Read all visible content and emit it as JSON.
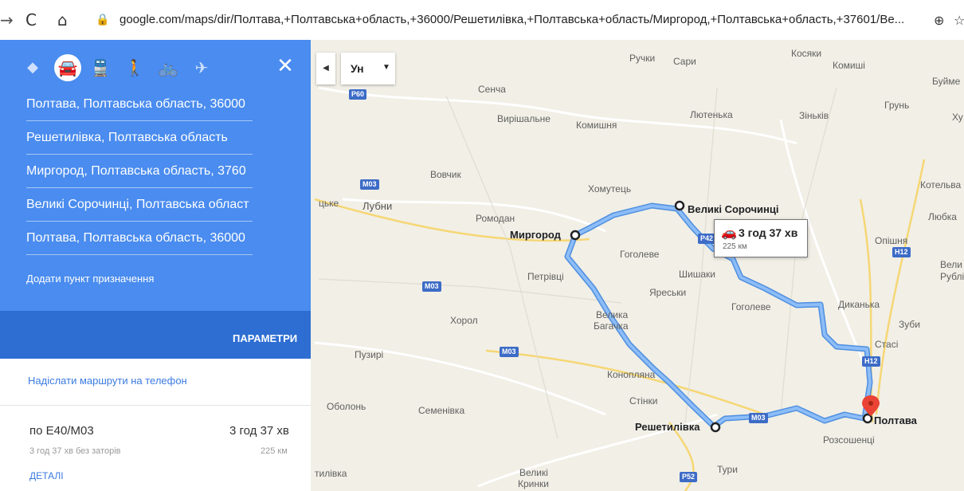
{
  "browser": {
    "url": "google.com/maps/dir/Полтава,+Полтавська+область,+36000/Решетилівка,+Полтавська+область/Миргород,+Полтавська+область,+37601/Ве..."
  },
  "panel": {
    "modes": [
      "directions-icon",
      "car-icon",
      "transit-icon",
      "walk-icon",
      "bike-icon",
      "flight-icon"
    ],
    "stops": [
      "Полтава, Полтавська область, 36000",
      "Решетилівка, Полтавська область",
      "Миргород, Полтавська область, 3760",
      "Великі Сорочинці, Полтавська област",
      "Полтава, Полтавська область, 36000"
    ],
    "add_destination": "Додати пункт призначення",
    "params_label": "ПАРАМЕТРИ",
    "send_to_phone": "Надіслати маршрути на телефон",
    "route": {
      "name": "по E40/M03",
      "time": "3 год 37 хв",
      "traffic": "3 год 37 хв без заторів",
      "distance": "225 км",
      "details": "ДЕТАЛІ"
    }
  },
  "map": {
    "layer_label": "Ун",
    "info": {
      "time": "3 год 37 хв",
      "distance": "225 км"
    },
    "stops": [
      {
        "name": "Миргород"
      },
      {
        "name": "Великі Сорочинці"
      },
      {
        "name": "Решетилівка"
      },
      {
        "name": "Полтава"
      }
    ],
    "places": [
      "Ручки",
      "Сари",
      "Косяки",
      "Комиші",
      "Буйме",
      "Сенча",
      "Вирішальне",
      "Комишня",
      "Лютенька",
      "Зіньків",
      "Грунь",
      "Ху",
      "Вовчик",
      "Хомутець",
      "Котельва",
      "цьке",
      "Лубни",
      "Ромодан",
      "Любка",
      "Опішня",
      "Гоголеве",
      "Вели",
      "Рублі",
      "Петрівці",
      "Шишаки",
      "Яреськи",
      "Гоголеве",
      "Диканька",
      "Велика",
      "Багачка",
      "Хорол",
      "Зуби",
      "Стасі",
      "Пузирі",
      "Конопляна",
      "Стінки",
      "Оболонь",
      "Семенівка",
      "Розсошенці",
      "тилівка",
      "Великі",
      "Кринки",
      "Тури"
    ],
    "roads": [
      "P60",
      "M03",
      "M03",
      "M03",
      "M03",
      "P42",
      "H12",
      "H12",
      "P52"
    ],
    "colors": {
      "route": "#76aef2",
      "route_stroke": "#4f8fe0",
      "destination_pin": "#ea4335"
    }
  }
}
